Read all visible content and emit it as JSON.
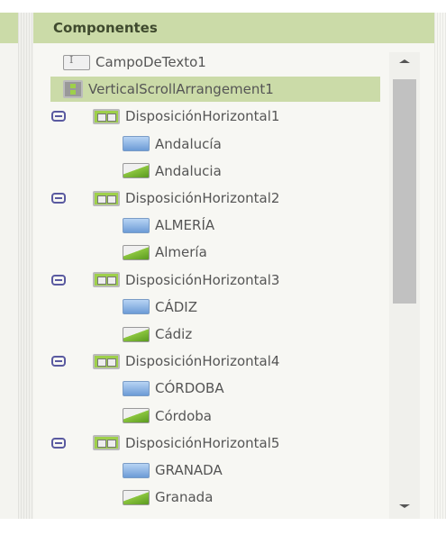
{
  "panel": {
    "title": "Componentes"
  },
  "tree": [
    {
      "label": "CampoDeTexto1",
      "icon": "textbox-icon",
      "level": 0
    },
    {
      "label": "VerticalScrollArrangement1",
      "icon": "vertical-arrangement-icon",
      "level": 0,
      "selected": true
    },
    {
      "label": "DisposiciónHorizontal1",
      "icon": "horizontal-arrangement-icon",
      "level": 1,
      "expanded": true
    },
    {
      "label": "Andalucía",
      "icon": "button-icon",
      "level": 2
    },
    {
      "label": "Andalucia",
      "icon": "image-icon",
      "level": 2
    },
    {
      "label": "DisposiciónHorizontal2",
      "icon": "horizontal-arrangement-icon",
      "level": 1,
      "expanded": true
    },
    {
      "label": "ALMERÍA",
      "icon": "button-icon",
      "level": 2
    },
    {
      "label": "Almería",
      "icon": "image-icon",
      "level": 2
    },
    {
      "label": "DisposiciónHorizontal3",
      "icon": "horizontal-arrangement-icon",
      "level": 1,
      "expanded": true
    },
    {
      "label": "CÁDIZ",
      "icon": "button-icon",
      "level": 2
    },
    {
      "label": "Cádiz",
      "icon": "image-icon",
      "level": 2
    },
    {
      "label": "DisposiciónHorizontal4",
      "icon": "horizontal-arrangement-icon",
      "level": 1,
      "expanded": true
    },
    {
      "label": "CÓRDOBA",
      "icon": "button-icon",
      "level": 2
    },
    {
      "label": "Córdoba",
      "icon": "image-icon",
      "level": 2
    },
    {
      "label": "DisposiciónHorizontal5",
      "icon": "horizontal-arrangement-icon",
      "level": 1,
      "expanded": true
    },
    {
      "label": "GRANADA",
      "icon": "button-icon",
      "level": 2
    },
    {
      "label": "Granada",
      "icon": "image-icon",
      "level": 2
    }
  ],
  "colors": {
    "header": "#cbdba8",
    "selected": "#cbdba8",
    "panel": "#f7f7f3"
  },
  "scrollbar": {
    "position_fraction": 0
  }
}
